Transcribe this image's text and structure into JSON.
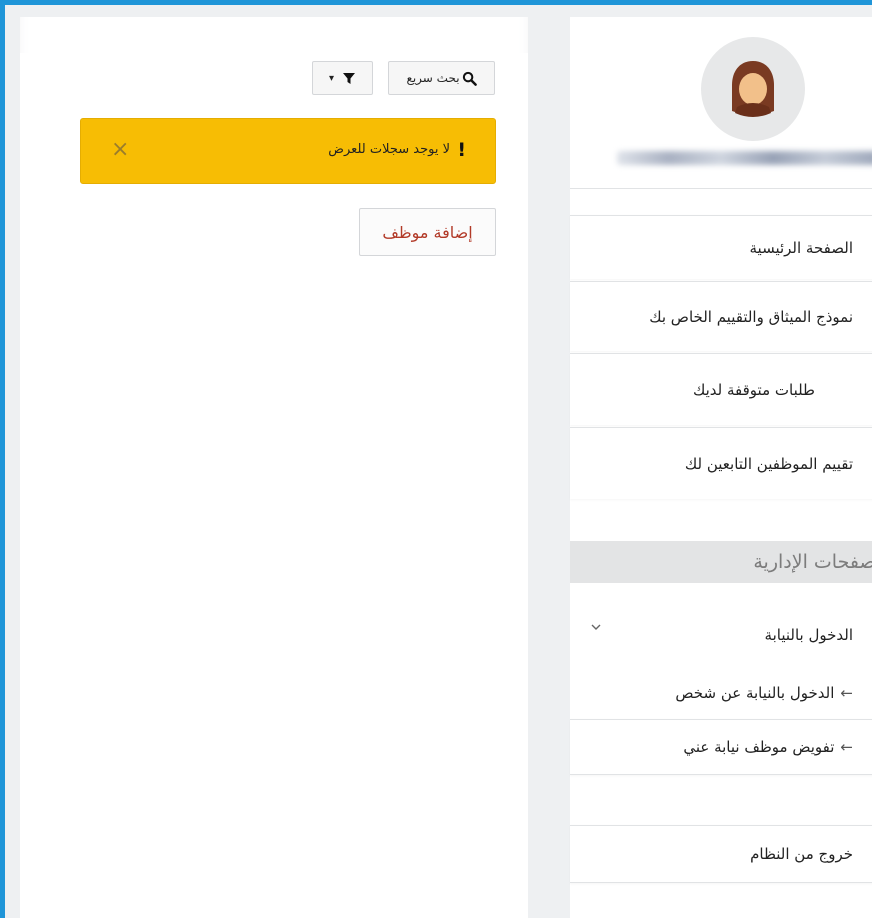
{
  "toolbar": {
    "search_label": "بحث سريع",
    "filter_caret": "▾"
  },
  "alert": {
    "message": "لا يوجد سجلات للعرض",
    "close": "×",
    "mark": "!",
    "color": "#f7bd04"
  },
  "actions": {
    "add_employee": "إضافة موظف"
  },
  "sidebar": {
    "items": [
      {
        "label": "الصفحة الرئيسية"
      },
      {
        "label": "نموذج الميثاق والتقييم الخاص بك"
      },
      {
        "label": "طلبات متوقفة لديك"
      },
      {
        "label": "تقييم الموظفين التابعين لك"
      }
    ],
    "section_title": "الصفحات الإدارية",
    "group": {
      "label": "الدخول بالنيابة",
      "children": [
        {
          "label": "الدخول بالنيابة عن شخص"
        },
        {
          "label": "تفويض موظف نيابة عني"
        }
      ]
    },
    "logout": "خروج من النظام"
  },
  "colors": {
    "frame": "#1f95d8",
    "accent_text": "#b23a28"
  }
}
